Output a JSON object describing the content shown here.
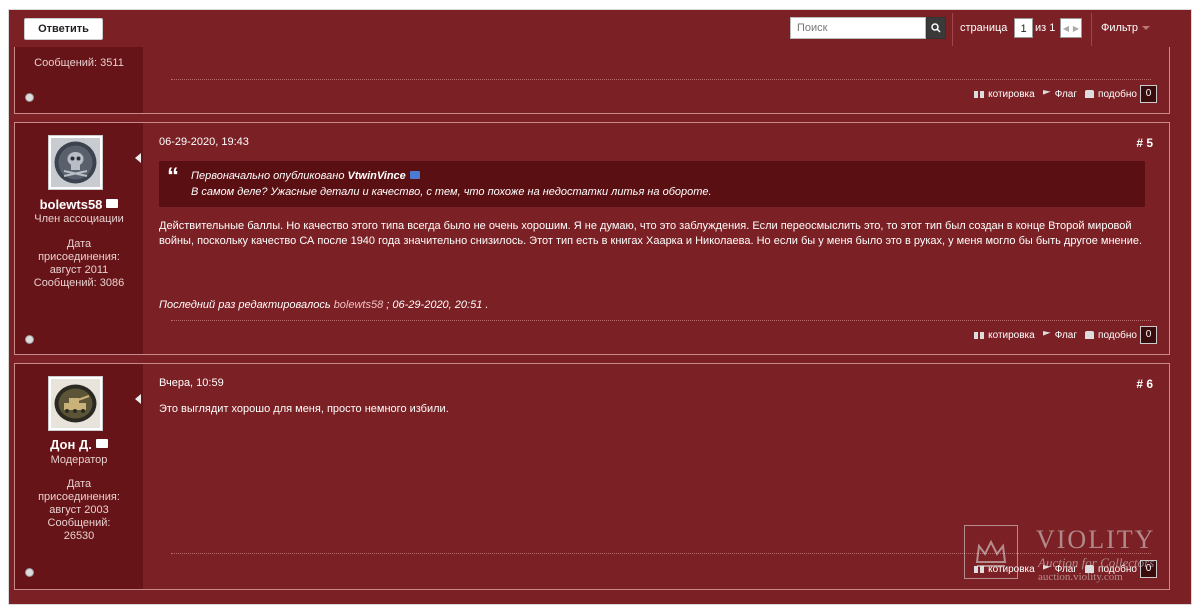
{
  "toolbar": {
    "reply_label": "Ответить",
    "search_placeholder": "Поиск",
    "page_label": "страница",
    "page_value": "1",
    "page_of": "из 1",
    "filter_label": "Фильтр"
  },
  "post0": {
    "posts_count_text": "Сообщений: 3511",
    "actions": {
      "quote": "котировка",
      "flag": "Флаг",
      "like": "подобно",
      "like_count": "0"
    }
  },
  "post1": {
    "username": "bolewts58",
    "rank": "Член ассоциации",
    "joined_label": "Дата присоединения:",
    "joined_value": "август 2011",
    "posts_count_text": "Сообщений: 3086",
    "date": "06-29-2020, 19:43",
    "number": "# 5",
    "quote": {
      "intro": "Первоначально опубликовано",
      "author": "VtwinVince",
      "text": "В самом деле? Ужасные детали и качество, с тем, что похоже на недостатки литья на обороте."
    },
    "text": "Действительные баллы. Но качество этого типа всегда было не очень хорошим. Я не думаю, что это заблуждения. Если переосмыслить это, то этот тип был создан в конце Второй мировой войны, поскольку качество СА после 1940 года значительно снизилось. Этот тип есть в книгах Хаарка и Николаева. Но если бы у меня было это в руках, у меня могло бы быть другое мнение.",
    "edited_prefix": "Последний раз редактировалось",
    "edited_user": "bolewts58",
    "edited_suffix": "; 06-29-2020, 20:51 .",
    "actions": {
      "quote": "котировка",
      "flag": "Флаг",
      "like": "подобно",
      "like_count": "0"
    }
  },
  "post2": {
    "username": "Дон Д.",
    "rank": "Модератор",
    "joined_label": "Дата присоединения:",
    "joined_value": "август 2003",
    "posts_count_label": "Сообщений:",
    "posts_count_value": "26530",
    "date": "Вчера, 10:59",
    "number": "# 6",
    "text": "Это выглядит хорошо для меня, просто немного избили.",
    "actions": {
      "quote": "котировка",
      "flag": "Флаг",
      "like": "подобно",
      "like_count": "0"
    }
  },
  "watermark": {
    "brand": "VIOLITY",
    "subtitle": "Auction for Collectors",
    "url": "auction.violity.com"
  },
  "colors": {
    "background": "#7b2024",
    "sidebar": "#661417",
    "quote_bg": "#5a0f12"
  }
}
